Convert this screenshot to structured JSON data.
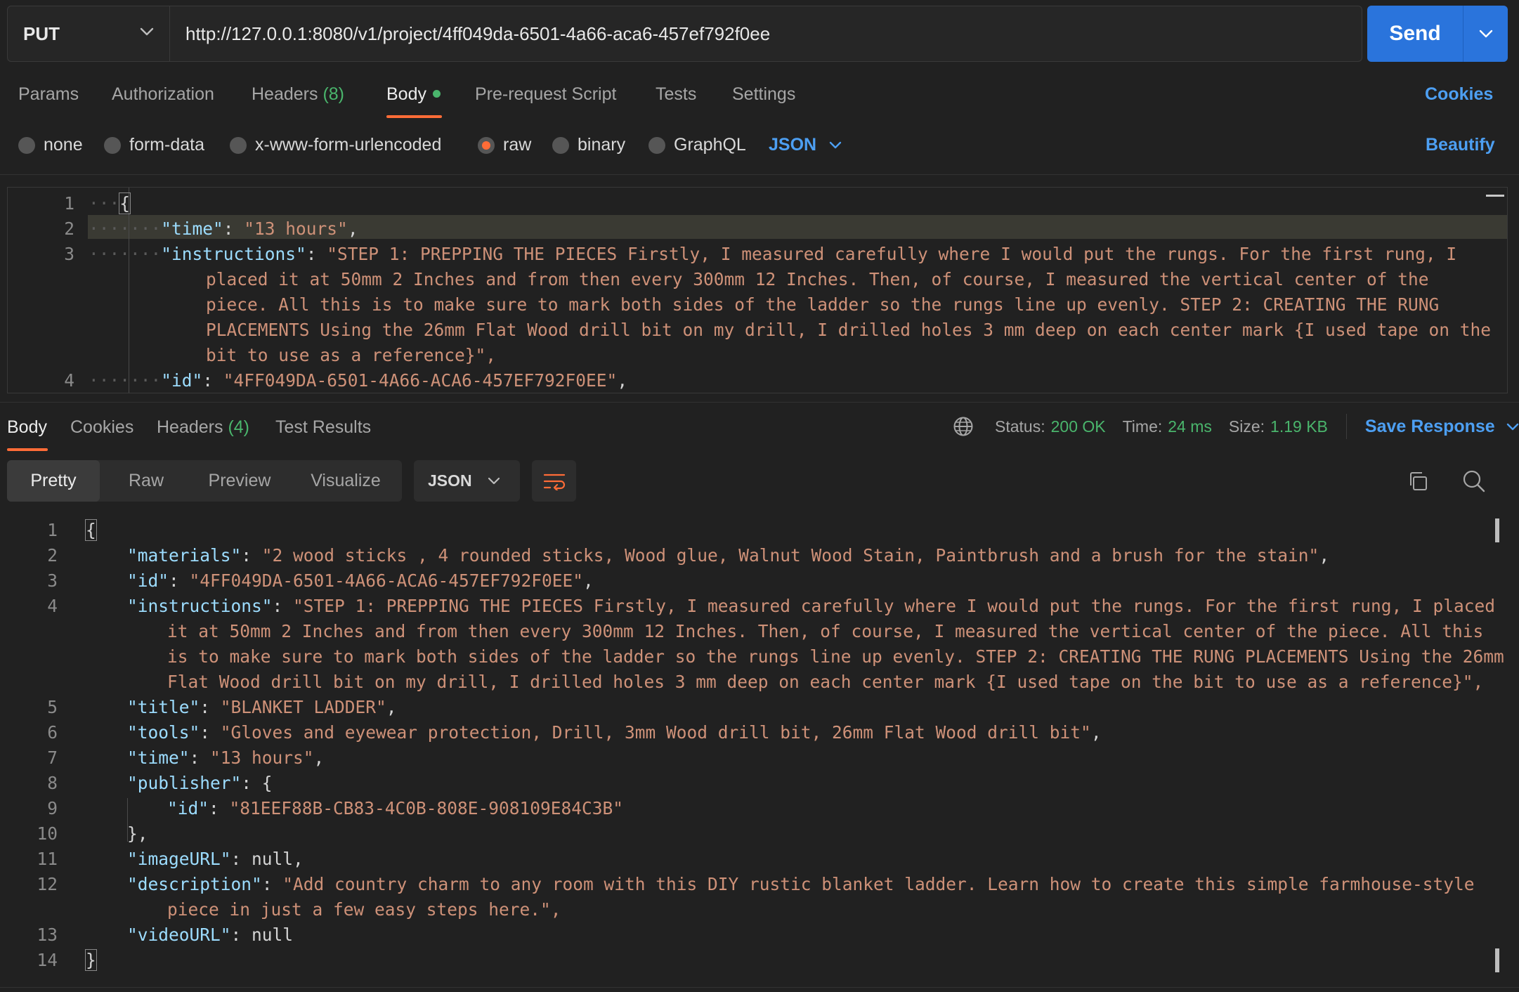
{
  "request": {
    "method": "PUT",
    "url": "http://127.0.0.1:8080/v1/project/4ff049da-6501-4a66-aca6-457ef792f0ee",
    "send_label": "Send"
  },
  "request_tabs": {
    "params": "Params",
    "authorization": "Authorization",
    "headers": "Headers",
    "headers_count": "(8)",
    "body": "Body",
    "pre_request": "Pre-request Script",
    "tests": "Tests",
    "settings": "Settings",
    "cookies": "Cookies"
  },
  "body_types": {
    "none": "none",
    "form_data": "form-data",
    "urlencoded": "x-www-form-urlencoded",
    "raw": "raw",
    "binary": "binary",
    "graphql": "GraphQL",
    "language": "JSON",
    "beautify": "Beautify"
  },
  "request_editor": {
    "line_numbers": [
      "1",
      "2",
      "3",
      "4"
    ],
    "open_brace": "{",
    "time_key": "\"time\"",
    "time_value": "\"13 hours\"",
    "instructions_key": "\"instructions\"",
    "instructions_lines": [
      "\"STEP 1: PREPPING THE PIECES Firstly, I measured carefully where I would put the rungs. For the first rung, I",
      "placed it at 50mm 2 Inches and from then every 300mm 12 Inches. Then, of course, I measured the vertical center of the",
      "piece. All this is to make sure to mark both sides of the ladder so the rungs line up evenly. STEP 2: CREATING THE RUNG",
      "PLACEMENTS Using the 26mm Flat Wood drill bit on my drill, I drilled holes 3 mm deep on each center mark {I used tape on the",
      "bit to use as a reference}\","
    ],
    "id_key": "\"id\"",
    "id_value": "\"4FF049DA-6501-4A66-ACA6-457EF792F0EE\""
  },
  "response_tabs": {
    "body": "Body",
    "cookies": "Cookies",
    "headers": "Headers",
    "headers_count": "(4)",
    "test_results": "Test Results"
  },
  "response_status": {
    "status_label": "Status:",
    "status_value": "200 OK",
    "time_label": "Time:",
    "time_value": "24 ms",
    "size_label": "Size:",
    "size_value": "1.19 KB",
    "save_response": "Save Response"
  },
  "response_view": {
    "pretty": "Pretty",
    "raw": "Raw",
    "preview": "Preview",
    "visualize": "Visualize",
    "format": "JSON"
  },
  "response_body": {
    "line_numbers": [
      "1",
      "2",
      "3",
      "4",
      "5",
      "6",
      "7",
      "8",
      "9",
      "10",
      "11",
      "12",
      "13",
      "14"
    ],
    "open_brace": "{",
    "close_brace": "}",
    "materials_key": "\"materials\"",
    "materials_value": "\"2 wood sticks , 4 rounded sticks, Wood glue, Walnut Wood Stain, Paintbrush and a brush for the stain\"",
    "id_key": "\"id\"",
    "id_value": "\"4FF049DA-6501-4A66-ACA6-457EF792F0EE\"",
    "instructions_key": "\"instructions\"",
    "instructions_lines": [
      "\"STEP 1: PREPPING THE PIECES Firstly, I measured carefully where I would put the rungs. For the first rung, I placed",
      "it at 50mm 2 Inches and from then every 300mm 12 Inches. Then, of course, I measured the vertical center of the piece. All this",
      "is to make sure to mark both sides of the ladder so the rungs line up evenly. STEP 2: CREATING THE RUNG PLACEMENTS Using the 26mm",
      "Flat Wood drill bit on my drill, I drilled holes 3 mm deep on each center mark {I used tape on the bit to use as a reference}\","
    ],
    "title_key": "\"title\"",
    "title_value": "\"BLANKET LADDER\"",
    "tools_key": "\"tools\"",
    "tools_value": "\"Gloves and eyewear protection, Drill, 3mm Wood drill bit, 26mm Flat Wood drill bit\"",
    "time_key": "\"time\"",
    "time_value": "\"13 hours\"",
    "publisher_key": "\"publisher\"",
    "publisher_id_key": "\"id\"",
    "publisher_id_value": "\"81EEF88B-CB83-4C0B-808E-908109E84C3B\"",
    "publisher_close": "},",
    "image_key": "\"imageURL\"",
    "image_value": "null",
    "description_key": "\"description\"",
    "description_lines": [
      "\"Add country charm to any room with this DIY rustic blanket ladder. Learn how to create this simple farmhouse-style",
      "piece in just a few easy steps here.\","
    ],
    "video_key": "\"videoURL\"",
    "video_value": "null"
  },
  "icons": {
    "method_dropdown": "chevron-down-icon",
    "send_dropdown": "chevron-down-icon",
    "language_dropdown": "chevron-down-icon",
    "globe": "globe-icon",
    "save_dropdown": "chevron-down-icon",
    "wrap": "wrap-lines-icon",
    "copy": "copy-icon",
    "search": "search-icon"
  },
  "colors": {
    "accent": "#ff6c37",
    "send_button": "#2a74dc",
    "link": "#4d9ff2",
    "success": "#4ab56c",
    "json_key": "#9cdcfe",
    "json_string": "#ce9178"
  }
}
